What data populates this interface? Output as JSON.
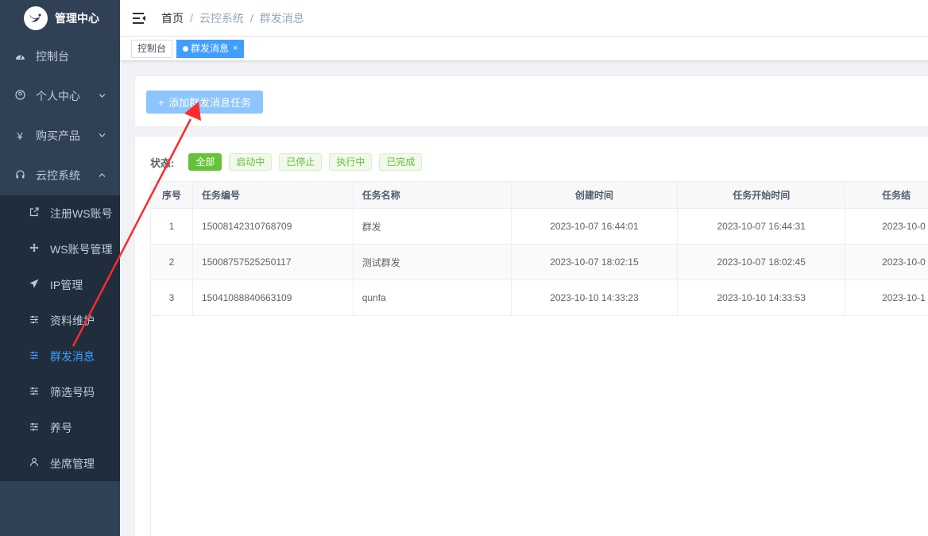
{
  "sidebar": {
    "brand": "管理中心",
    "menu": {
      "console": "控制台",
      "personal": "个人中心",
      "purchase": "购买产品",
      "cloud": "云控系统"
    },
    "sub": {
      "register_ws": "注册WS账号",
      "ws_manage": "WS账号管理",
      "ip_manage": "IP管理",
      "data_maintain": "资料维护",
      "bulk_message": "群发消息",
      "filter_numbers": "筛选号码",
      "nurture": "养号",
      "seat_manage": "坐席管理"
    }
  },
  "breadcrumb": {
    "home": "首页",
    "section": "云控系统",
    "current": "群发消息",
    "sep": "/"
  },
  "tags": {
    "console": "控制台",
    "active": "群发消息",
    "close": "×"
  },
  "toolbar": {
    "add_label": "添加群发消息任务",
    "plus": "+"
  },
  "filter": {
    "label": "状态:",
    "all": "全部",
    "running": "启动中",
    "stopped": "已停止",
    "executing": "执行中",
    "done": "已完成"
  },
  "table": {
    "headers": {
      "index": "序号",
      "task_no": "任务编号",
      "task_name": "任务名称",
      "created": "创建时间",
      "start": "任务开始时间",
      "end": "任务结"
    },
    "rows": [
      {
        "index": "1",
        "task_no": "15008142310768709",
        "task_name": "群发",
        "created": "2023-10-07 16:44:01",
        "start": "2023-10-07 16:44:31",
        "end": "2023-10-0"
      },
      {
        "index": "2",
        "task_no": "15008757525250117",
        "task_name": "测试群发",
        "created": "2023-10-07 18:02:15",
        "start": "2023-10-07 18:02:45",
        "end": "2023-10-0"
      },
      {
        "index": "3",
        "task_no": "15041088840663109",
        "task_name": "qunfa",
        "created": "2023-10-10 14:33:23",
        "start": "2023-10-10 14:33:53",
        "end": "2023-10-1"
      }
    ]
  },
  "colors": {
    "sidebar_bg": "#304156",
    "submenu_bg": "#1f2d3d",
    "primary": "#409eff",
    "success": "#67c23a",
    "annotation": "#ff2a2a"
  }
}
